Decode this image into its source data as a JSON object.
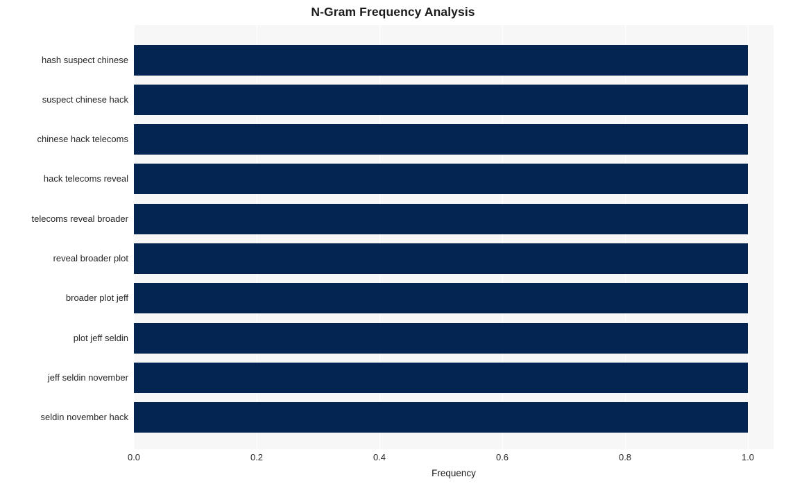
{
  "chart_data": {
    "type": "bar",
    "orientation": "horizontal",
    "title": "N-Gram Frequency Analysis",
    "xlabel": "Frequency",
    "ylabel": "",
    "categories": [
      "hash suspect chinese",
      "suspect chinese hack",
      "chinese hack telecoms",
      "hack telecoms reveal",
      "telecoms reveal broader",
      "reveal broader plot",
      "broader plot jeff",
      "plot jeff seldin",
      "jeff seldin november",
      "seldin november hack"
    ],
    "values": [
      1.0,
      1.0,
      1.0,
      1.0,
      1.0,
      1.0,
      1.0,
      1.0,
      1.0,
      1.0
    ],
    "xlim": [
      0.0,
      1.0
    ],
    "xticks": [
      0.0,
      0.2,
      0.4,
      0.6,
      0.8,
      1.0
    ],
    "xtick_labels": [
      "0.0",
      "0.2",
      "0.4",
      "0.6",
      "0.8",
      "1.0"
    ],
    "grid": true,
    "grid_axis": "x",
    "legend": null,
    "bar_color": "#042451",
    "plot_background": "#f7f7f7",
    "figure_background": "#ffffff",
    "gridline_color": "#ffffff",
    "text_color": "#262626"
  }
}
